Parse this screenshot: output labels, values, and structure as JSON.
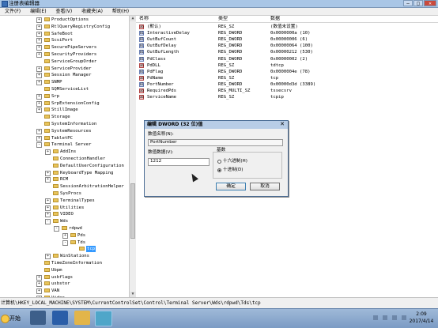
{
  "window": {
    "title": "注册表编辑器",
    "buttons": {
      "min": "—",
      "max": "□",
      "close": "✕"
    }
  },
  "menu": [
    "文件(F)",
    "编辑(E)",
    "查看(V)",
    "收藏夹(A)",
    "帮助(H)"
  ],
  "tree": [
    {
      "label": "ProductOptions",
      "depth": 1,
      "exp": "+"
    },
    {
      "label": "RtlQueryRegistryConfig",
      "depth": 1,
      "exp": "+"
    },
    {
      "label": "SafeBoot",
      "depth": 1,
      "exp": "+"
    },
    {
      "label": "ScsiPort",
      "depth": 1,
      "exp": "+"
    },
    {
      "label": "SecurePipeServers",
      "depth": 1,
      "exp": "+"
    },
    {
      "label": "SecurityProviders",
      "depth": 1,
      "exp": "+"
    },
    {
      "label": "ServiceGroupOrder",
      "depth": 1,
      "exp": ""
    },
    {
      "label": "ServiceProvider",
      "depth": 1,
      "exp": "+"
    },
    {
      "label": "Session Manager",
      "depth": 1,
      "exp": "+"
    },
    {
      "label": "SNMP",
      "depth": 1,
      "exp": "+"
    },
    {
      "label": "SQMServiceList",
      "depth": 1,
      "exp": ""
    },
    {
      "label": "Srp",
      "depth": 1,
      "exp": "+"
    },
    {
      "label": "SrpExtensionConfig",
      "depth": 1,
      "exp": "+"
    },
    {
      "label": "StillImage",
      "depth": 1,
      "exp": "+"
    },
    {
      "label": "Storage",
      "depth": 1,
      "exp": ""
    },
    {
      "label": "SystemInformation",
      "depth": 1,
      "exp": ""
    },
    {
      "label": "SystemResources",
      "depth": 1,
      "exp": "+"
    },
    {
      "label": "TabletPC",
      "depth": 1,
      "exp": "+"
    },
    {
      "label": "Terminal Server",
      "depth": 1,
      "exp": "-"
    },
    {
      "label": "AddIns",
      "depth": 2,
      "exp": "+"
    },
    {
      "label": "ConnectionHandler",
      "depth": 2,
      "exp": ""
    },
    {
      "label": "DefaultUserConfiguration",
      "depth": 2,
      "exp": ""
    },
    {
      "label": "KeyboardType Mapping",
      "depth": 2,
      "exp": "+"
    },
    {
      "label": "RCM",
      "depth": 2,
      "exp": "+"
    },
    {
      "label": "SessionArbitrationHelper",
      "depth": 2,
      "exp": ""
    },
    {
      "label": "SysProcs",
      "depth": 2,
      "exp": ""
    },
    {
      "label": "TerminalTypes",
      "depth": 2,
      "exp": "+"
    },
    {
      "label": "Utilities",
      "depth": 2,
      "exp": "+"
    },
    {
      "label": "VIDEO",
      "depth": 2,
      "exp": "+"
    },
    {
      "label": "Wds",
      "depth": 2,
      "exp": "-"
    },
    {
      "label": "rdpwd",
      "depth": 3,
      "exp": "-"
    },
    {
      "label": "Pds",
      "depth": 4,
      "exp": "+"
    },
    {
      "label": "Tds",
      "depth": 4,
      "exp": "-"
    },
    {
      "label": "tcp",
      "depth": 5,
      "exp": "",
      "selected": true
    },
    {
      "label": "WinStations",
      "depth": 2,
      "exp": "+"
    },
    {
      "label": "TimeZoneInformation",
      "depth": 1,
      "exp": ""
    },
    {
      "label": "Ubpm",
      "depth": 1,
      "exp": ""
    },
    {
      "label": "usbflags",
      "depth": 1,
      "exp": "+"
    },
    {
      "label": "usbstor",
      "depth": 1,
      "exp": "+"
    },
    {
      "label": "VAN",
      "depth": 1,
      "exp": "+"
    },
    {
      "label": "Video",
      "depth": 1,
      "exp": "+"
    }
  ],
  "columns": {
    "name": "名称",
    "type": "类型",
    "data": "数据"
  },
  "values": [
    {
      "name": "(默认)",
      "type": "REG_SZ",
      "data": "(数值未设置)",
      "kind": "sz"
    },
    {
      "name": "InteractiveDelay",
      "type": "REG_DWORD",
      "data": "0x0000000a (10)",
      "kind": "bin"
    },
    {
      "name": "OutBufCount",
      "type": "REG_DWORD",
      "data": "0x00000006 (6)",
      "kind": "bin"
    },
    {
      "name": "OutBufDelay",
      "type": "REG_DWORD",
      "data": "0x00000064 (100)",
      "kind": "bin"
    },
    {
      "name": "OutBufLength",
      "type": "REG_DWORD",
      "data": "0x00000212 (530)",
      "kind": "bin"
    },
    {
      "name": "PdClass",
      "type": "REG_DWORD",
      "data": "0x00000002 (2)",
      "kind": "bin"
    },
    {
      "name": "PdDLL",
      "type": "REG_SZ",
      "data": "tdtcp",
      "kind": "sz"
    },
    {
      "name": "PdFlag",
      "type": "REG_DWORD",
      "data": "0x0000004e (78)",
      "kind": "bin"
    },
    {
      "name": "PdName",
      "type": "REG_SZ",
      "data": "tcp",
      "kind": "sz"
    },
    {
      "name": "PortNumber",
      "type": "REG_DWORD",
      "data": "0x00000d3d (3389)",
      "kind": "bin"
    },
    {
      "name": "RequiredPds",
      "type": "REG_MULTI_SZ",
      "data": "tssecsrv",
      "kind": "sz"
    },
    {
      "name": "ServiceName",
      "type": "REG_SZ",
      "data": "tcpip",
      "kind": "sz"
    }
  ],
  "dialog": {
    "title": "编辑 DWORD (32 位)值",
    "close": "✕",
    "name_label": "数值名称(N):",
    "name_value": "PortNumber",
    "data_label": "数值数据(V):",
    "data_value": "1212",
    "base_label": "基数",
    "hex_label": "十六进制(H)",
    "dec_label": "十进制(D)",
    "ok": "确定",
    "cancel": "取消"
  },
  "status": "计算机\\HKEY_LOCAL_MACHINE\\SYSTEM\\CurrentControlSet\\Control\\Terminal Server\\Wds\\rdpwd\\Tds\\tcp",
  "taskbar": {
    "start": "开始",
    "time": "2:09",
    "date": "2017/4/14"
  }
}
